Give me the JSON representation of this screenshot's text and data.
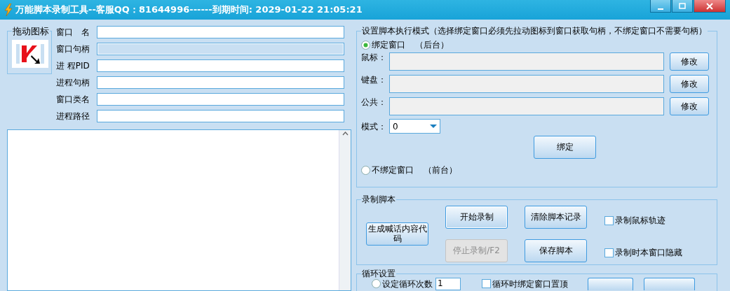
{
  "window": {
    "title": "万能脚本录制工具--客服QQ：81644996------到期时间: 2029-01-22 21:05:21"
  },
  "drag_icon": {
    "label": "拖动图标"
  },
  "fields": [
    {
      "label": "窗口　名",
      "disabled": false
    },
    {
      "label": "窗口句柄",
      "disabled": true
    },
    {
      "label": "进 程PID",
      "disabled": false
    },
    {
      "label": "进程句柄",
      "disabled": false
    },
    {
      "label": "窗口类名",
      "disabled": false
    },
    {
      "label": "进程路径",
      "disabled": false
    }
  ],
  "mode": {
    "title": "设置脚本执行模式（选择绑定窗口必须先拉动图标到窗口获取句柄，不绑定窗口不需要句柄）",
    "bind_option": {
      "label": "绑定窗口",
      "note": "（后台）",
      "selected": true
    },
    "rows": [
      {
        "label": "鼠标：",
        "button": "修改"
      },
      {
        "label": "键盘：",
        "button": "修改"
      },
      {
        "label": "公共：",
        "button": "修改"
      }
    ],
    "mode_label": "模式：",
    "mode_value": "0",
    "bind_button": "绑定",
    "unbind_option": {
      "label": "不绑定窗口",
      "note": "（前台）",
      "selected": false
    }
  },
  "record": {
    "title": "录制脚本",
    "buttons": [
      {
        "label": "生成喊话内容代码",
        "disabled": false
      },
      {
        "label": "开始录制",
        "disabled": false
      },
      {
        "label": "停止录制/F2",
        "disabled": true
      },
      {
        "label": "清除脚本记录",
        "disabled": false
      },
      {
        "label": "保存脚本",
        "disabled": false
      }
    ],
    "checkboxes": [
      {
        "label": "录制鼠标轨迹",
        "checked": false
      },
      {
        "label": "录制时本窗口隐藏",
        "checked": false
      }
    ]
  },
  "loop": {
    "title": "循环设置",
    "count_option": {
      "label": "设定循环次数",
      "selected": false
    },
    "count_value": "1",
    "topmost": {
      "label": "循环时绑定窗口置顶",
      "checked": false
    }
  }
}
